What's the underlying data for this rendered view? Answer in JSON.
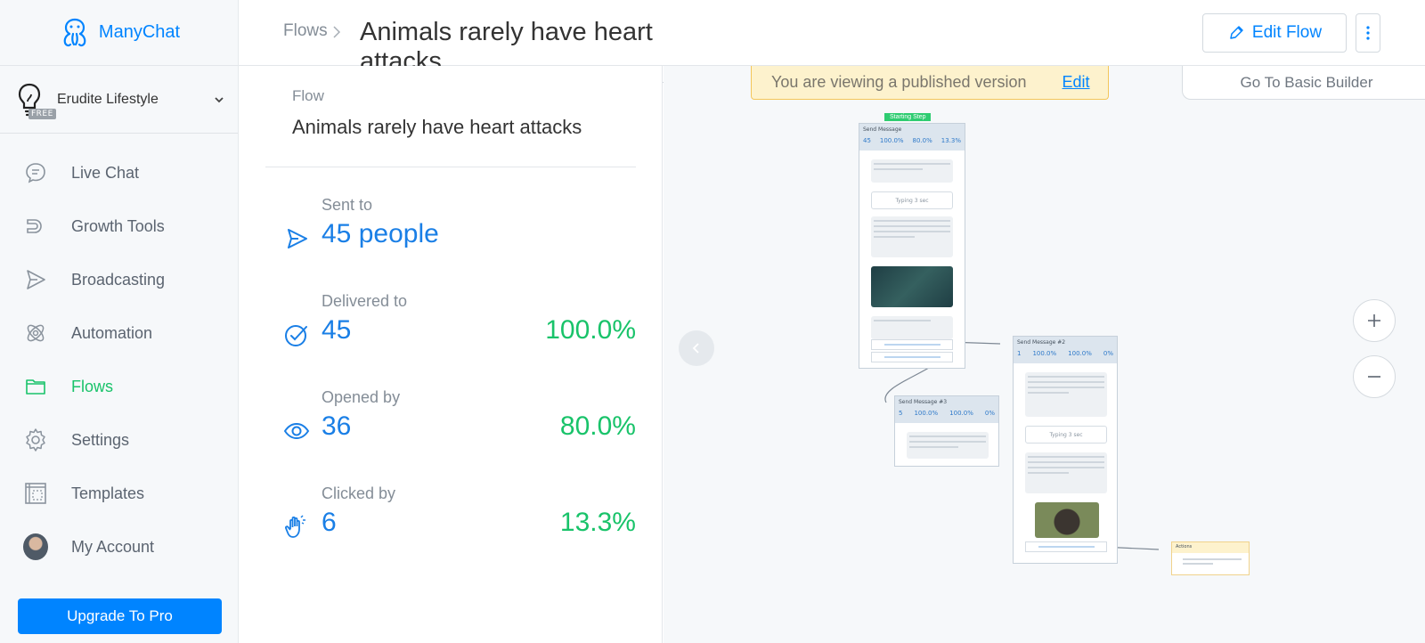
{
  "app": {
    "name": "ManyChat",
    "brand_color": "#0084ff",
    "accent_green": "#19c36a"
  },
  "account": {
    "name": "Erudite Lifestyle",
    "badge": "FREE",
    "icon": "lightbulb-icon"
  },
  "nav": {
    "items": [
      {
        "label": "Live Chat",
        "icon": "chat-bubble-icon",
        "active": false
      },
      {
        "label": "Growth Tools",
        "icon": "magnet-icon",
        "active": false
      },
      {
        "label": "Broadcasting",
        "icon": "send-icon",
        "active": false
      },
      {
        "label": "Automation",
        "icon": "atom-icon",
        "active": false
      },
      {
        "label": "Flows",
        "icon": "folder-icon",
        "active": true
      },
      {
        "label": "Settings",
        "icon": "gear-icon",
        "active": false
      },
      {
        "label": "Templates",
        "icon": "templates-icon",
        "active": false
      },
      {
        "label": "My Account",
        "icon": "avatar",
        "active": false
      }
    ],
    "upgrade_label": "Upgrade To Pro"
  },
  "header": {
    "breadcrumb": "Flows",
    "flow_title": "Animals rarely have heart attacks",
    "edit_flow_label": "Edit Flow"
  },
  "stats_panel": {
    "flow_label": "Flow",
    "flow_name": "Animals rarely have heart attacks",
    "stats": [
      {
        "label": "Sent to",
        "value": "45 people",
        "percent": "",
        "icon": "send-icon"
      },
      {
        "label": "Delivered to",
        "value": "45",
        "percent": "100.0%",
        "icon": "check-circle-icon"
      },
      {
        "label": "Opened by",
        "value": "36",
        "percent": "80.0%",
        "icon": "eye-icon"
      },
      {
        "label": "Clicked by",
        "value": "6",
        "percent": "13.3%",
        "icon": "hand-pointer-icon"
      }
    ]
  },
  "canvas": {
    "banner_text": "You are viewing a published version",
    "banner_edit": "Edit",
    "basic_builder": "Go To Basic Builder",
    "zoom_in": "+",
    "zoom_out": "−",
    "starting_step": "Starting Step",
    "node1": {
      "title": "Send Message",
      "stats": [
        "45",
        "100.0%",
        "80.0%",
        "13.3%"
      ],
      "typing": "Typing 3 sec"
    },
    "node2": {
      "title": "Send Message #2",
      "stats": [
        "1",
        "100.0%",
        "100.0%",
        "0%"
      ],
      "typing": "Typing 3 sec"
    },
    "node3": {
      "title": "Send Message #3",
      "stats": [
        "5",
        "100.0%",
        "100.0%",
        "0%"
      ]
    },
    "node4": {
      "title": "Actions"
    }
  }
}
